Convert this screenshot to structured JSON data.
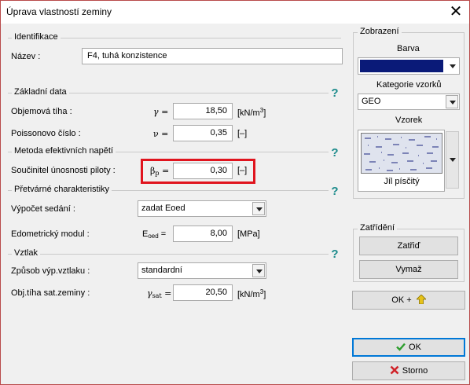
{
  "window": {
    "title": "Úprava vlastností zeminy",
    "close_glyph": "✕"
  },
  "identifikace": {
    "section_title": "Identifikace",
    "name_label": "Název :",
    "name_value": "F4, tuhá konzistence"
  },
  "zakladni_data": {
    "section_title": "Základní data",
    "unit_weight": {
      "label": "Objemová tíha :",
      "symbol": "γ =",
      "value": "18,50",
      "unit_pre": "[kN/m",
      "unit_exp": "3",
      "unit_post": "]"
    },
    "poisson": {
      "label": "Poissonovo číslo :",
      "symbol": "ν =",
      "value": "0,35",
      "unit": "[–]"
    }
  },
  "metoda": {
    "section_title": "Metoda efektivních napětí",
    "pile_coef": {
      "label": "Součinitel únosnosti piloty :",
      "symbol_main": "β",
      "symbol_sub": "p",
      "symbol_eq": "=",
      "value": "0,30",
      "unit": "[–]"
    }
  },
  "pretvarne": {
    "section_title": "Přetvárné charakteristiky",
    "settlement": {
      "label": "Výpočet sedání :",
      "selected": "zadat Eoed"
    },
    "oedometric": {
      "label": "Edometrický modul :",
      "symbol_main": "E",
      "symbol_sub": "oed",
      "symbol_eq": "=",
      "value": "8,00",
      "unit": "[MPa]"
    }
  },
  "vztlak": {
    "section_title": "Vztlak",
    "method": {
      "label": "Způsob výp.vztlaku :",
      "selected": "standardní"
    },
    "sat_weight": {
      "label": "Obj.tíha sat.zeminy :",
      "symbol_main": "γ",
      "symbol_sub": "sat",
      "symbol_eq": "=",
      "value": "20,50",
      "unit_pre": "[kN/m",
      "unit_exp": "3",
      "unit_post": "]"
    }
  },
  "help_glyph": "?",
  "zobrazeni": {
    "title": "Zobrazení",
    "color_label": "Barva",
    "color_value": "#0a1a78",
    "category_label": "Kategorie vzorků",
    "category_selected": "GEO",
    "sample_label": "Vzorek",
    "sample_name": "Jíl písčitý"
  },
  "zatrideni": {
    "title": "Zatřídění",
    "classify_button": "Zatřiď",
    "delete_button": "Vymaž"
  },
  "ok_plus_button": "OK +",
  "ok_button": "OK",
  "cancel_button": "Storno",
  "colors": {
    "accent_blue": "#0078d7",
    "highlight_red": "#e0141e",
    "help_teal": "#1a8a8a",
    "ok_green": "#2e9e2e",
    "cancel_red": "#d0242a",
    "arrow_yellow": "#e6c21a"
  }
}
